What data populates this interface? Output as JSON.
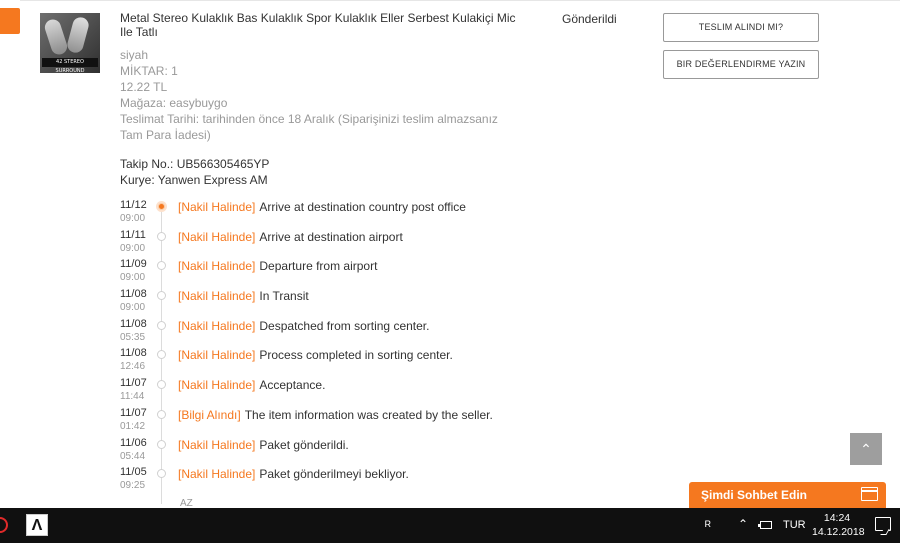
{
  "order": {
    "title": "Metal Stereo Kulaklık Bas Kulaklık Spor Kulaklık Eller Serbest Kulakiçi Mic Ile Tatlı",
    "image_caption": "42 STEREO SURROUND",
    "color": "siyah",
    "quantity": "MİKTAR: 1",
    "price": "12.22 TL",
    "store": "Mağaza: easybuygo",
    "delivery_note": "Teslimat Tarihi: tarihinden önce 18 Aralık (Siparişinizi teslim almazsanız Tam Para İadesi)",
    "status": "Gönderildi",
    "tracking_no": "Takip No.: UB566305465YP",
    "courier": "Kurye: Yanwen Express AM"
  },
  "actions": {
    "confirm_delivery": "TESLIM ALINDI MI?",
    "write_review": "BIR DEĞERLENDIRME YAZIN"
  },
  "timeline": [
    {
      "date": "11/12",
      "time": "09:00",
      "tag": "[Nakil Halinde]",
      "text": "Arrive at destination country post office"
    },
    {
      "date": "11/11",
      "time": "09:00",
      "tag": "[Nakil Halinde]",
      "text": "Arrive at destination airport"
    },
    {
      "date": "11/09",
      "time": "09:00",
      "tag": "[Nakil Halinde]",
      "text": "Departure from airport"
    },
    {
      "date": "11/08",
      "time": "09:00",
      "tag": "[Nakil Halinde]",
      "text": "In Transit"
    },
    {
      "date": "11/08",
      "time": "05:35",
      "tag": "[Nakil Halinde]",
      "text": "Despatched from sorting center."
    },
    {
      "date": "11/08",
      "time": "12:46",
      "tag": "[Nakil Halinde]",
      "text": "Process completed in sorting center."
    },
    {
      "date": "11/07",
      "time": "11:44",
      "tag": "[Nakil Halinde]",
      "text": "Acceptance."
    },
    {
      "date": "11/07",
      "time": "01:42",
      "tag": "[Bilgi Alındı]",
      "text": "The item information was created by the seller."
    },
    {
      "date": "11/06",
      "time": "05:44",
      "tag": "[Nakil Halinde]",
      "text": "Paket gönderildi."
    },
    {
      "date": "11/05",
      "time": "09:25",
      "tag": "[Nakil Halinde]",
      "text": "Paket gönderilmeyi bekliyor."
    }
  ],
  "timeline_more": "AZ",
  "chat": {
    "label": "Şimdi Sohbet Edin"
  },
  "scroll_top_glyph": "⌃",
  "taskbar": {
    "app_glyph": "Ʌ",
    "people_glyph": "ᴿ",
    "chevron_glyph": "⌃",
    "lang": "TUR",
    "time": "14:24",
    "date": "14.12.2018"
  },
  "colors": {
    "accent": "#f5781f",
    "muted": "#999999",
    "taskbar": "#101010"
  }
}
